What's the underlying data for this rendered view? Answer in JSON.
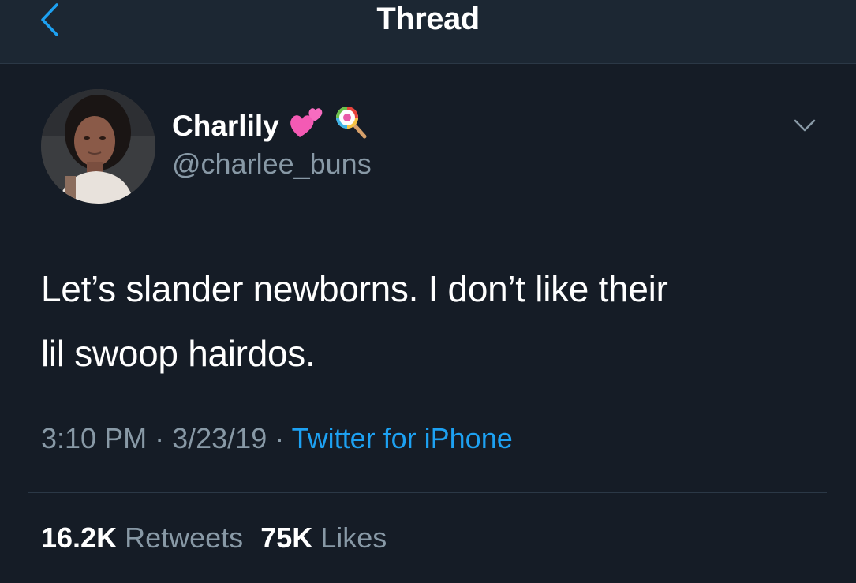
{
  "nav": {
    "title": "Thread",
    "back_icon": "chevron-left-icon"
  },
  "tweet": {
    "author_name": "Charlily",
    "name_emojis": [
      "two-hearts-emoji",
      "lollipop-emoji"
    ],
    "handle": "@charlee_buns",
    "text_line1": "Let’s slander newborns. I don’t like their",
    "text_line2": "lil swoop hairdos.",
    "time": "3:10 PM",
    "date": "3/23/19",
    "separator": "·",
    "source": "Twitter for iPhone",
    "retweets_count": "16.2K",
    "retweets_label": "Retweets",
    "likes_count": "75K",
    "likes_label": "Likes"
  },
  "colors": {
    "background": "#151c26",
    "navbar": "#1c2733",
    "accent": "#1da1f2",
    "secondary_text": "#8899a6"
  }
}
